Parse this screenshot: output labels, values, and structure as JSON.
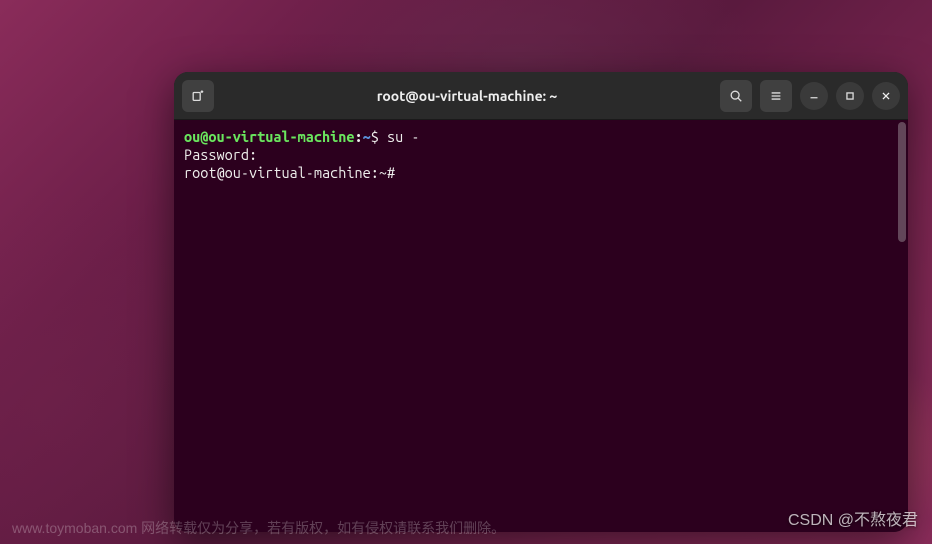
{
  "window": {
    "title": "root@ou-virtual-machine: ~"
  },
  "terminal": {
    "line1": {
      "user_host": "ou@ou-virtual-machine",
      "colon": ":",
      "path": "~",
      "symbol": "$ ",
      "command": "su -"
    },
    "line2": "Password: ",
    "line3": "root@ou-virtual-machine:~# "
  },
  "watermarks": {
    "bottom_left": "www.toymoban.com 网络转载仅为分享，若有版权，如有侵权请联系我们删除。",
    "bottom_right": "CSDN @不熬夜君"
  }
}
